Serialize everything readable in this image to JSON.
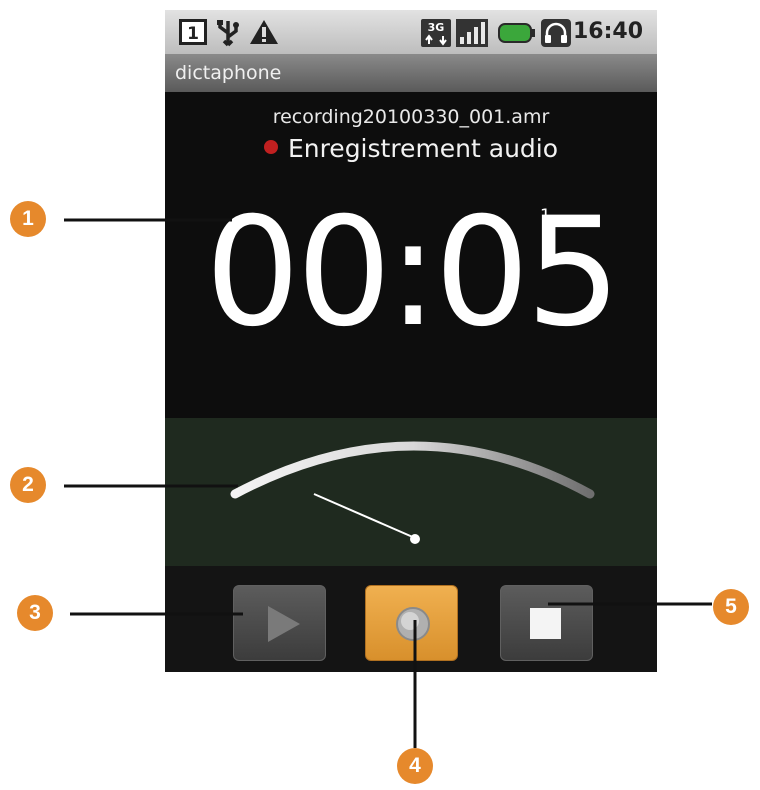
{
  "status_bar": {
    "sim_icon": "sim-1-icon",
    "usb_icon": "usb-icon",
    "warning_icon": "warning-icon",
    "network_icon": "3g-icon",
    "signal_icon": "signal-icon",
    "battery_icon": "battery-icon",
    "headset_icon": "headset-icon",
    "time": "16:40",
    "sim_label": "1",
    "network_label": "3G"
  },
  "app": {
    "title": "dictaphone"
  },
  "recording": {
    "filename": "recording20100330_001.amr",
    "status_text": "Enregistrement audio",
    "elapsed": "00:05",
    "superscript": "1"
  },
  "controls": {
    "play": "play-icon",
    "record": "record-icon",
    "stop": "stop-icon"
  },
  "callouts": [
    "1",
    "2",
    "3",
    "4",
    "5"
  ],
  "colors": {
    "callout": "#e6892c",
    "record_button": "#e8a040",
    "record_dot": "#c02020",
    "screen_bg": "#0d0d0d",
    "meter_bg": "#1f2a1f"
  }
}
